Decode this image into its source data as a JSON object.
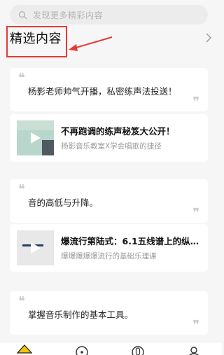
{
  "search": {
    "placeholder": "发现更多精彩内容"
  },
  "section": {
    "title": "精选内容"
  },
  "feed": [
    {
      "kind": "quote",
      "text": "杨影老师帅气开播，私密练声法投送！"
    },
    {
      "kind": "course",
      "title": "不再跑调的练声秘笈大公开！",
      "subtitle": "杨影音乐教室X学会唱歌的捷径"
    },
    {
      "kind": "quote",
      "text": "音的高低与升降。"
    },
    {
      "kind": "course",
      "title": "爆流行第陆式：6.1五线谱上的纵…",
      "subtitle": "爆爆爆爆爆流行的基础乐理课"
    },
    {
      "kind": "quote",
      "text": "掌握音乐制作的基本工具。"
    }
  ],
  "tabbar": {
    "icons": [
      "home-icon",
      "discover-icon",
      "mic-icon",
      "profile-icon"
    ]
  },
  "colors": {
    "annotation": "#e53935",
    "accent": "#f5c400"
  }
}
